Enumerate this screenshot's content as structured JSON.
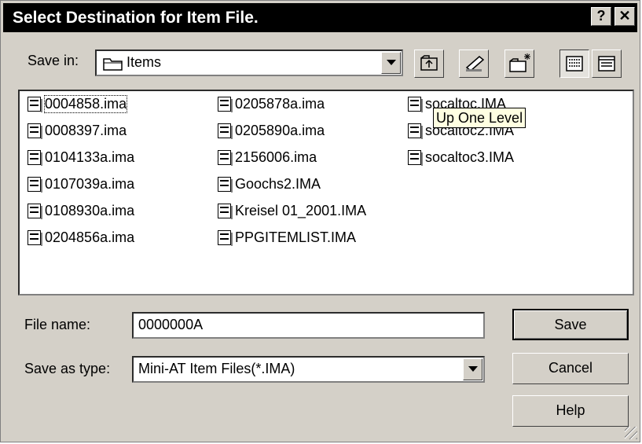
{
  "titlebar": {
    "title": "Select Destination for Item File.",
    "help_label": "?",
    "close_label": "✕"
  },
  "save_in": {
    "label": "Save in:",
    "value": "Items"
  },
  "toolbar": {
    "tooltip": "Up One Level"
  },
  "files": [
    {
      "name": "0004858.ima",
      "selected": true
    },
    {
      "name": "0008397.ima"
    },
    {
      "name": "0104133a.ima"
    },
    {
      "name": "0107039a.ima"
    },
    {
      "name": "0108930a.ima"
    },
    {
      "name": "0204856a.ima"
    },
    {
      "name": "0205878a.ima"
    },
    {
      "name": "0205890a.ima"
    },
    {
      "name": "2156006.ima"
    },
    {
      "name": "Goochs2.IMA"
    },
    {
      "name": "Kreisel 01_2001.IMA"
    },
    {
      "name": "PPGITEMLIST.IMA"
    },
    {
      "name": "socaltoc.IMA"
    },
    {
      "name": "socaltoc2.IMA"
    },
    {
      "name": "socaltoc3.IMA"
    }
  ],
  "file_name": {
    "label": "File name:",
    "value": "0000000A"
  },
  "save_as_type": {
    "label": "Save as type:",
    "value": "Mini-AT Item Files(*.IMA)"
  },
  "buttons": {
    "save": "Save",
    "cancel": "Cancel",
    "help": "Help"
  }
}
